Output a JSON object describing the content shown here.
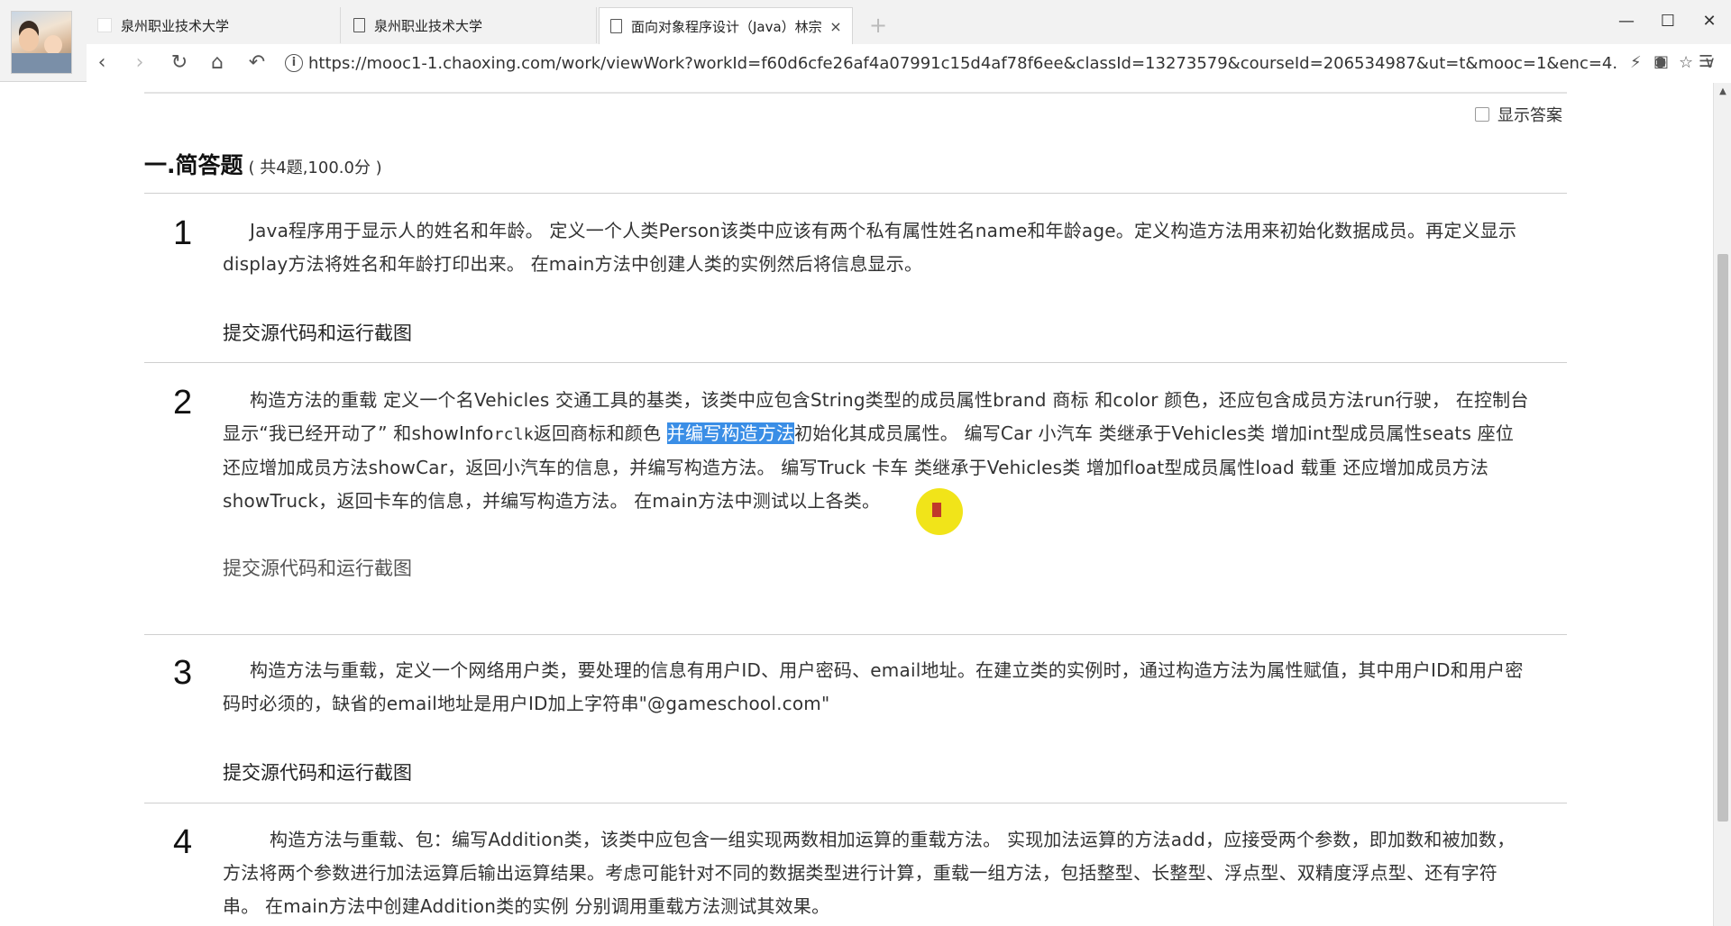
{
  "browser": {
    "tabs": [
      {
        "label": "泉州职业技术大学",
        "active": false,
        "favicon": "blank-page-icon"
      },
      {
        "label": "泉州职业技术大学",
        "active": false,
        "favicon": "document-icon"
      },
      {
        "label": "面向对象程序设计（Java）林宗",
        "active": true,
        "favicon": "document-icon",
        "close": "×"
      }
    ],
    "new_tab": "+",
    "window_controls": {
      "minimize": "—",
      "maximize": "☐",
      "close": "✕"
    },
    "nav": {
      "back": "‹",
      "forward": "›",
      "reload": "↻",
      "home": "⌂",
      "undo": "↶"
    },
    "url": "https://mooc1-1.chaoxing.com/work/viewWork?workId=f60d6cfe26af4a07991c15d4af78f6ee&classId=13273579&courseId=206534987&ut=t&mooc=1&enc=4...",
    "url_icons": {
      "flash": "⚡",
      "zoom": "⊕",
      "star": "☆",
      "dropdown": "∨",
      "extension": "▣",
      "menu": "☰"
    }
  },
  "page": {
    "show_answer_label": "显示答案",
    "section": {
      "title": "一.简答题",
      "subtitle": "( 共4题,100.0分 )"
    },
    "questions": [
      {
        "num": "1",
        "text": "Java程序用于显示人的姓名和年龄。 定义一个人类Person该类中应该有两个私有属性姓名name和年龄age。定义构造方法用来初始化数据成员。再定义显示display方法将姓名和年龄打印出来。 在main方法中创建人类的实例然后将信息显示。",
        "submit": "提交源代码和运行截图"
      },
      {
        "num": "2",
        "text_before": "构造方法的重载 定义一个名Vehicles 交通工具的基类，该类中应包含String类型的成员属性brand 商标  和color 颜色，还应包含成员方法run行驶， 在控制台显示“我已经开动了” 和showInfo",
        "text_mono": "rclk",
        "text_mid": "返回商标和颜色 ",
        "highlighted": "并编写构造方法",
        "text_after": "初始化其成员属性。 编写Car 小汽车  类继承于Vehicles类  增加int型成员属性seats 座位  还应增加成员方法showCar，返回小汽车的信息，并编写构造方法。 编写Truck 卡车  类继承于Vehicles类  增加float型成员属性load 载重  还应增加成员方法showTruck，返回卡车的信息，并编写构造方法。 在main方法中测试以上各类。",
        "submit": "提交源代码和运行截图"
      },
      {
        "num": "3",
        "text": "构造方法与重载，定义一个网络用户类，要处理的信息有用户ID、用户密码、email地址。在建立类的实例时，通过构造方法为属性赋值，其中用户ID和用户密码时必须的，缺省的email地址是用户ID加上字符串\"@gameschool.com\"",
        "submit": "提交源代码和运行截图"
      },
      {
        "num": "4",
        "text": "构造方法与重载、包：编写Addition类，该类中应包含一组实现两数相加运算的重载方法。 实现加法运算的方法add，应接受两个参数，即加数和被加数，方法将两个参数进行加法运算后输出运算结果。考虑可能针对不同的数据类型进行计算，重载一组方法，包括整型、长整型、浮点型、双精度浮点型、还有字符串。 在main方法中创建Addition类的实例  分别调用重载方法测试其效果。"
      }
    ]
  }
}
